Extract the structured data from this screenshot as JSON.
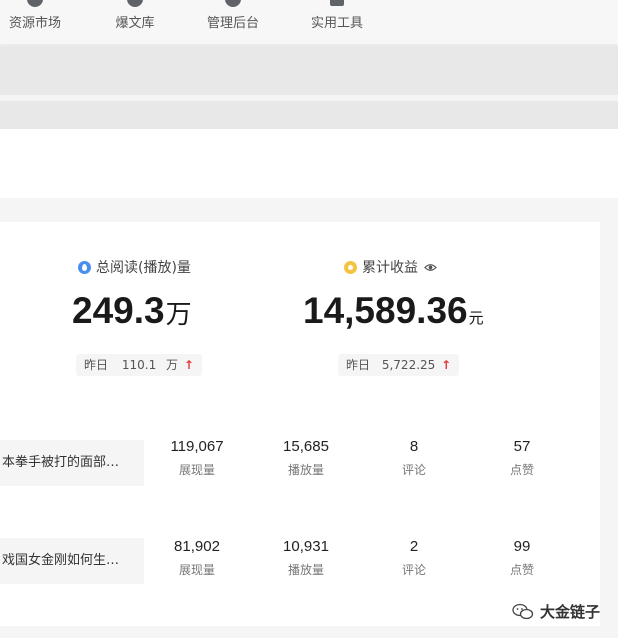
{
  "nav": {
    "items": [
      {
        "label": "资源市场"
      },
      {
        "label": "爆文库"
      },
      {
        "label": "管理后台"
      },
      {
        "label": "实用工具"
      }
    ]
  },
  "stats": {
    "reads": {
      "icon": "droplet-icon",
      "title": "总阅读(播放)量",
      "value": "249.3",
      "unit": "万",
      "yesterday_label": "昨日",
      "yesterday_value": "110.1",
      "yesterday_unit": "万",
      "trend": "↑"
    },
    "income": {
      "icon": "coin-icon",
      "title": "累计收益",
      "value": "14,589.36",
      "unit": "元",
      "yesterday_label": "昨日",
      "yesterday_value": "5,722.25",
      "trend": "↑"
    }
  },
  "articles": [
    {
      "title": "本拳手被打的面部…",
      "metrics": [
        {
          "value": "119,067",
          "label": "展现量"
        },
        {
          "value": "15,685",
          "label": "播放量"
        },
        {
          "value": "8",
          "label": "评论"
        },
        {
          "value": "57",
          "label": "点赞"
        }
      ]
    },
    {
      "title": "戏国女金刚如何生…",
      "metrics": [
        {
          "value": "81,902",
          "label": "展现量"
        },
        {
          "value": "10,931",
          "label": "播放量"
        },
        {
          "value": "2",
          "label": "评论"
        },
        {
          "value": "99",
          "label": "点赞"
        }
      ]
    }
  ],
  "watermark": {
    "text": "大金链子"
  },
  "colors": {
    "accent_blue": "#4a8ef0",
    "accent_gold": "#f5c342",
    "trend_up": "#e23c3c"
  }
}
